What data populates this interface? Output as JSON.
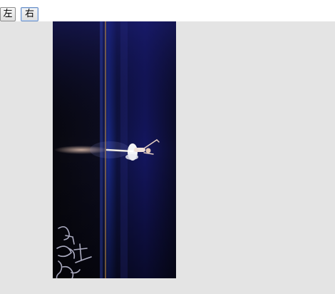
{
  "toolbar": {
    "rotate_left_label": "左",
    "rotate_right_label": "右"
  },
  "photo": {
    "subject": "ballerina-rotated",
    "watermark_text": "轻舞飞扬"
  },
  "colors": {
    "page_background": "#e4e4e4",
    "toolbar_background": "#ffffff",
    "photo_dark": "#0a0a16",
    "photo_blue": "#1b2070"
  }
}
